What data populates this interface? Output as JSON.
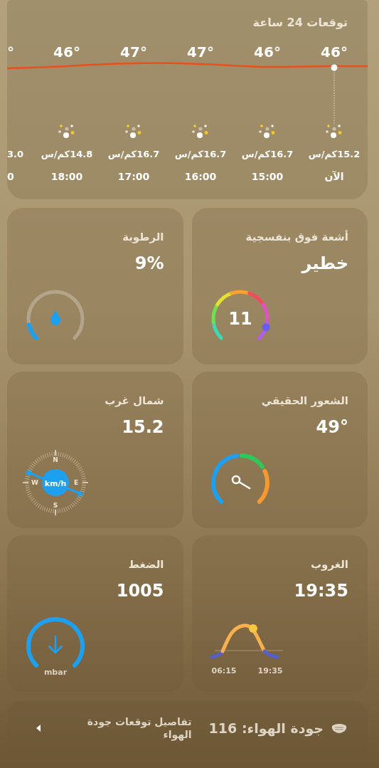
{
  "forecast": {
    "title": "توقعات 24 ساعة",
    "hours": [
      {
        "temp": "46°",
        "wind": "15.2كم/س",
        "time": "الآن",
        "cut": false
      },
      {
        "temp": "46°",
        "wind": "16.7كم/س",
        "time": "15:00",
        "cut": false
      },
      {
        "temp": "47°",
        "wind": "16.7كم/س",
        "time": "16:00",
        "cut": false
      },
      {
        "temp": "47°",
        "wind": "16.7كم/س",
        "time": "17:00",
        "cut": false
      },
      {
        "temp": "46°",
        "wind": "14.8كم/س",
        "time": "18:00",
        "cut": false
      },
      {
        "temp": "°",
        "wind": "3.0",
        "time": "0",
        "cut": true
      }
    ]
  },
  "tiles": [
    {
      "kind": "uv",
      "title": "أشعة فوق بنفسجية",
      "value": "خطير",
      "reading": "11"
    },
    {
      "kind": "humidity",
      "title": "الرطوبة",
      "value": "9%"
    },
    {
      "kind": "feels_like",
      "title": "الشعور الحقيقي",
      "value": "49°"
    },
    {
      "kind": "wind",
      "title": "شمال غرب",
      "value": "15.2",
      "labels": [
        "N",
        "W",
        "E",
        "S"
      ],
      "unit": "km/h"
    },
    {
      "kind": "sunset",
      "title": "الغروب",
      "value": "19:35",
      "sunrise_time": "06:15",
      "sunset_time": "19:35"
    },
    {
      "kind": "pressure",
      "title": "الضغط",
      "value": "1005",
      "unit": "mbar"
    }
  ],
  "air_quality": {
    "label": "جودة الهواء: 116",
    "link": "تفاصيل توقعات جودة الهواء"
  }
}
